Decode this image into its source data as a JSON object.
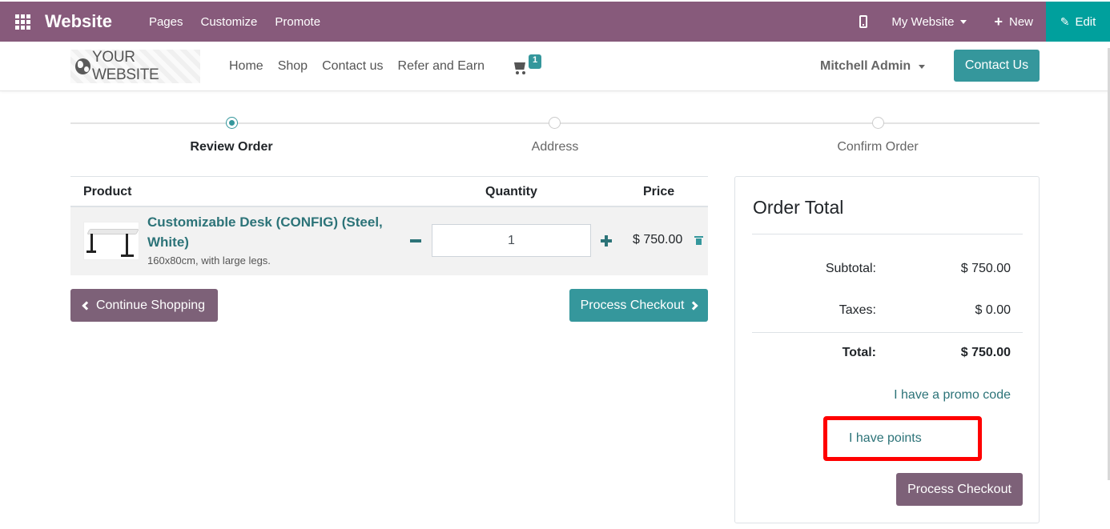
{
  "admin_bar": {
    "brand": "Website",
    "menu": [
      "Pages",
      "Customize",
      "Promote"
    ],
    "website_selector": "My Website",
    "new_label": "New",
    "edit_label": "Edit"
  },
  "site_nav": {
    "logo_text": "YOUR WEBSITE",
    "menu": [
      "Home",
      "Shop",
      "Contact us",
      "Refer and Earn"
    ],
    "cart_count": "1",
    "user": "Mitchell Admin",
    "contact_button": "Contact Us"
  },
  "wizard": {
    "steps": [
      "Review Order",
      "Address",
      "Confirm Order"
    ],
    "active_index": 0
  },
  "cart": {
    "headers": {
      "product": "Product",
      "quantity": "Quantity",
      "price": "Price"
    },
    "items": [
      {
        "name": "Customizable Desk (CONFIG) (Steel, White)",
        "description": "160x80cm, with large legs.",
        "quantity": "1",
        "price": "$ 750.00"
      }
    ],
    "continue_label": "Continue Shopping",
    "process_label": "Process Checkout"
  },
  "order_total": {
    "title": "Order Total",
    "subtotal_label": "Subtotal:",
    "subtotal_value": "$ 750.00",
    "taxes_label": "Taxes:",
    "taxes_value": "$ 0.00",
    "total_label": "Total:",
    "total_value": "$ 750.00",
    "promo_link": "I have a promo code",
    "points_link": "I have points",
    "process_label": "Process Checkout"
  },
  "colors": {
    "admin_purple": "#875a7b",
    "teal": "#35979c",
    "edit_teal": "#00a09d",
    "link_teal": "#2c7378",
    "secondary_btn": "#7d6178",
    "highlight_red": "#ff0000"
  }
}
